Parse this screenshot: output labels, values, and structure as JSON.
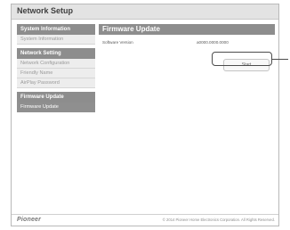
{
  "window": {
    "title": "Network Setup"
  },
  "sidebar": {
    "sections": [
      {
        "heading": "System Information",
        "items": [
          {
            "label": "System Information"
          }
        ]
      },
      {
        "heading": "Network Setting",
        "items": [
          {
            "label": "Network Configuration"
          },
          {
            "label": "Friendly Name"
          },
          {
            "label": "AirPlay Password"
          }
        ]
      },
      {
        "heading": "Firmware Update",
        "items": [
          {
            "label": "Firmware Update"
          }
        ]
      }
    ]
  },
  "main": {
    "title": "Firmware Update",
    "software_version_label": "Software Version",
    "software_version_value": "a0000.0000.0000",
    "start_button_label": "Start"
  },
  "footer": {
    "brand": "Pioneer",
    "copyright": "© 2014 Pioneer Home Electronics Corporation. All Rights Reserved."
  }
}
